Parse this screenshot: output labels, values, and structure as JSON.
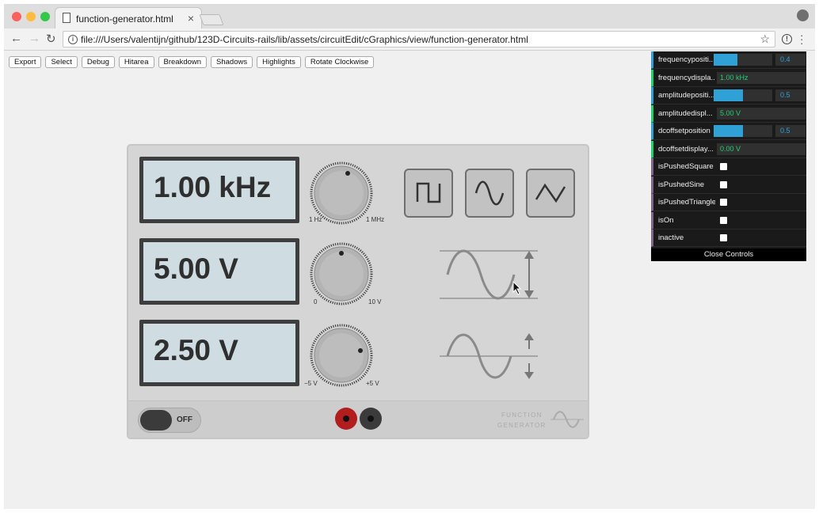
{
  "tab": {
    "title": "function-generator.html"
  },
  "address": {
    "url": "file:///Users/valentijn/github/123D-Circuits-rails/lib/assets/circuitEdit/cGraphics/view/function-generator.html"
  },
  "debug_buttons": [
    "Export",
    "Select",
    "Debug",
    "Hitarea",
    "Breakdown",
    "Shadows",
    "Highlights",
    "Rotate Clockwise"
  ],
  "device": {
    "freq_display": "1.00 kHz",
    "amp_display": "5.00 V",
    "offset_display": "2.50 V",
    "freq_min": "1 Hz",
    "freq_max": "1 MHz",
    "amp_min": "0",
    "amp_max": "10 V",
    "offset_min": "−5 V",
    "offset_max": "+5 V",
    "power_label": "OFF",
    "brand_line1": "FUNCTION",
    "brand_line2": "GENERATOR",
    "colors": {
      "jack_red": "#b21d1d",
      "jack_black": "#3b3b3b",
      "lcd": "#cfdde2"
    },
    "icons": [
      "square-wave-icon",
      "sine-wave-icon",
      "triangle-wave-icon"
    ]
  },
  "controls": {
    "rows": [
      {
        "label": "frequencypositi...",
        "type": "number",
        "value": "0.4",
        "fraction": 0.4
      },
      {
        "label": "frequencydispla...",
        "type": "string",
        "value": "1.00 kHz"
      },
      {
        "label": "amplitudepositi...",
        "type": "number",
        "value": "0.5",
        "fraction": 0.5
      },
      {
        "label": "amplitudedispl...",
        "type": "string",
        "value": "5.00 V"
      },
      {
        "label": "dcoffsetposition",
        "type": "number",
        "value": "0.5",
        "fraction": 0.5
      },
      {
        "label": "dcoffsetdisplay...",
        "type": "string",
        "value": "0.00 V"
      },
      {
        "label": "isPushedSquare",
        "type": "boolean"
      },
      {
        "label": "isPushedSine",
        "type": "boolean"
      },
      {
        "label": "isPushedTriangle",
        "type": "boolean"
      },
      {
        "label": "isOn",
        "type": "boolean"
      },
      {
        "label": "inactive",
        "type": "boolean"
      }
    ],
    "close_label": "Close Controls"
  }
}
